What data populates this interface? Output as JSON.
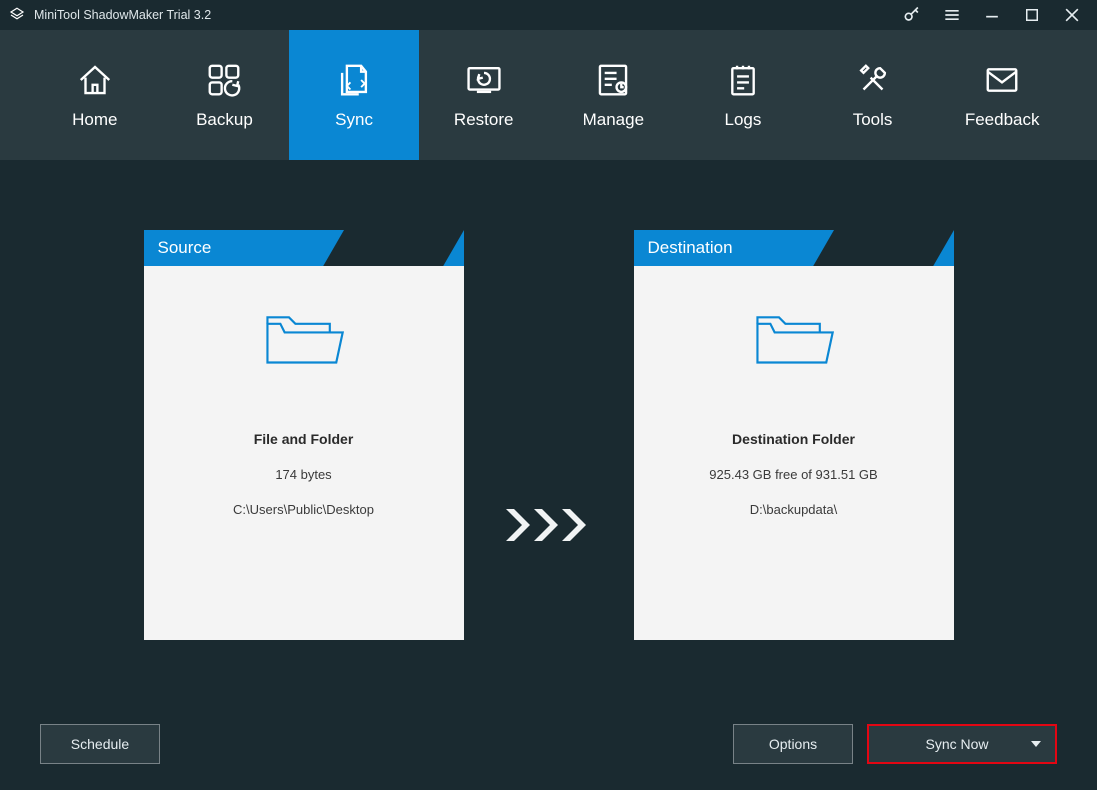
{
  "titlebar": {
    "title": "MiniTool ShadowMaker Trial 3.2"
  },
  "nav": {
    "items": [
      {
        "label": "Home"
      },
      {
        "label": "Backup"
      },
      {
        "label": "Sync"
      },
      {
        "label": "Restore"
      },
      {
        "label": "Manage"
      },
      {
        "label": "Logs"
      },
      {
        "label": "Tools"
      },
      {
        "label": "Feedback"
      }
    ],
    "active_index": 2
  },
  "source": {
    "header": "Source",
    "title": "File and Folder",
    "size": "174 bytes",
    "path": "C:\\Users\\Public\\Desktop"
  },
  "destination": {
    "header": "Destination",
    "title": "Destination Folder",
    "free": "925.43 GB free of 931.51 GB",
    "path": "D:\\backupdata\\"
  },
  "footer": {
    "schedule": "Schedule",
    "options": "Options",
    "sync_now": "Sync Now"
  }
}
